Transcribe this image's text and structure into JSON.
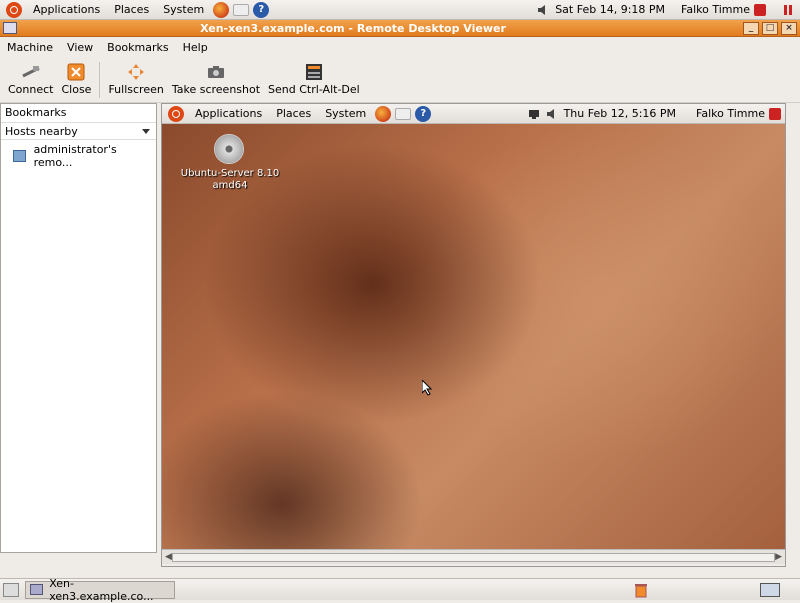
{
  "top_panel": {
    "menus": [
      "Applications",
      "Places",
      "System"
    ],
    "clock": "Sat Feb 14,  9:18 PM",
    "user": "Falko Timme"
  },
  "window": {
    "title": "Xen-xen3.example.com - Remote Desktop Viewer",
    "menubar": [
      "Machine",
      "View",
      "Bookmarks",
      "Help"
    ],
    "toolbar": {
      "connect": "Connect",
      "close": "Close",
      "fullscreen": "Fullscreen",
      "screenshot": "Take screenshot",
      "ctrl_alt_del": "Send Ctrl-Alt-Del"
    }
  },
  "sidebar": {
    "bookmarks_header": "Bookmarks",
    "hosts_nearby": "Hosts nearby",
    "hosts": [
      "administrator's remo..."
    ]
  },
  "remote": {
    "menus": [
      "Applications",
      "Places",
      "System"
    ],
    "clock": "Thu Feb 12,  5:16 PM",
    "user": "Falko Timme",
    "desktop_icon_label_line1": "Ubuntu-Server 8.10",
    "desktop_icon_label_line2": "amd64"
  },
  "taskbar": {
    "task": "Xen-xen3.example.co..."
  },
  "colors": {
    "titlebar": "#e27a1d",
    "ubuntu_orange": "#dd4814"
  }
}
